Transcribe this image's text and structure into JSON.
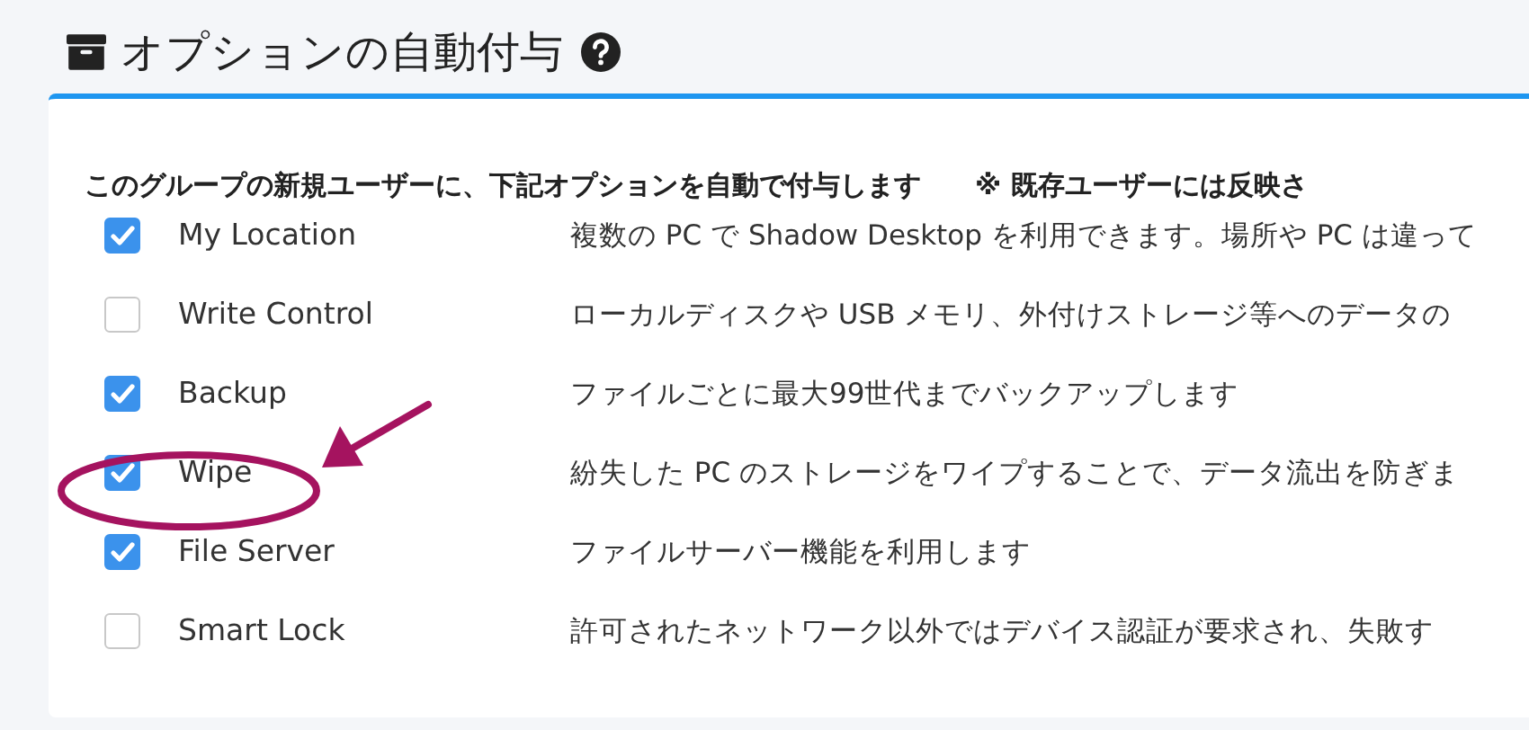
{
  "header": {
    "title": "オプションの自動付与"
  },
  "card": {
    "intro": "このグループの新規ユーザーに、下記オプションを自動で付与します",
    "note": "※ 既存ユーザーには反映さ",
    "options": [
      {
        "label": "My Location",
        "checked": true,
        "description": "複数の PC で Shadow Desktop を利用できます。場所や PC は違って"
      },
      {
        "label": "Write Control",
        "checked": false,
        "description": "ローカルディスクや USB メモリ、外付けストレージ等へのデータの"
      },
      {
        "label": "Backup",
        "checked": true,
        "description": "ファイルごとに最大99世代までバックアップします"
      },
      {
        "label": "Wipe",
        "checked": true,
        "description": "紛失した PC のストレージをワイプすることで、データ流出を防ぎま"
      },
      {
        "label": "File Server",
        "checked": true,
        "description": "ファイルサーバー機能を利用します"
      },
      {
        "label": "Smart Lock",
        "checked": false,
        "description": "許可されたネットワーク以外ではデバイス認証が要求され、失敗す"
      }
    ]
  }
}
